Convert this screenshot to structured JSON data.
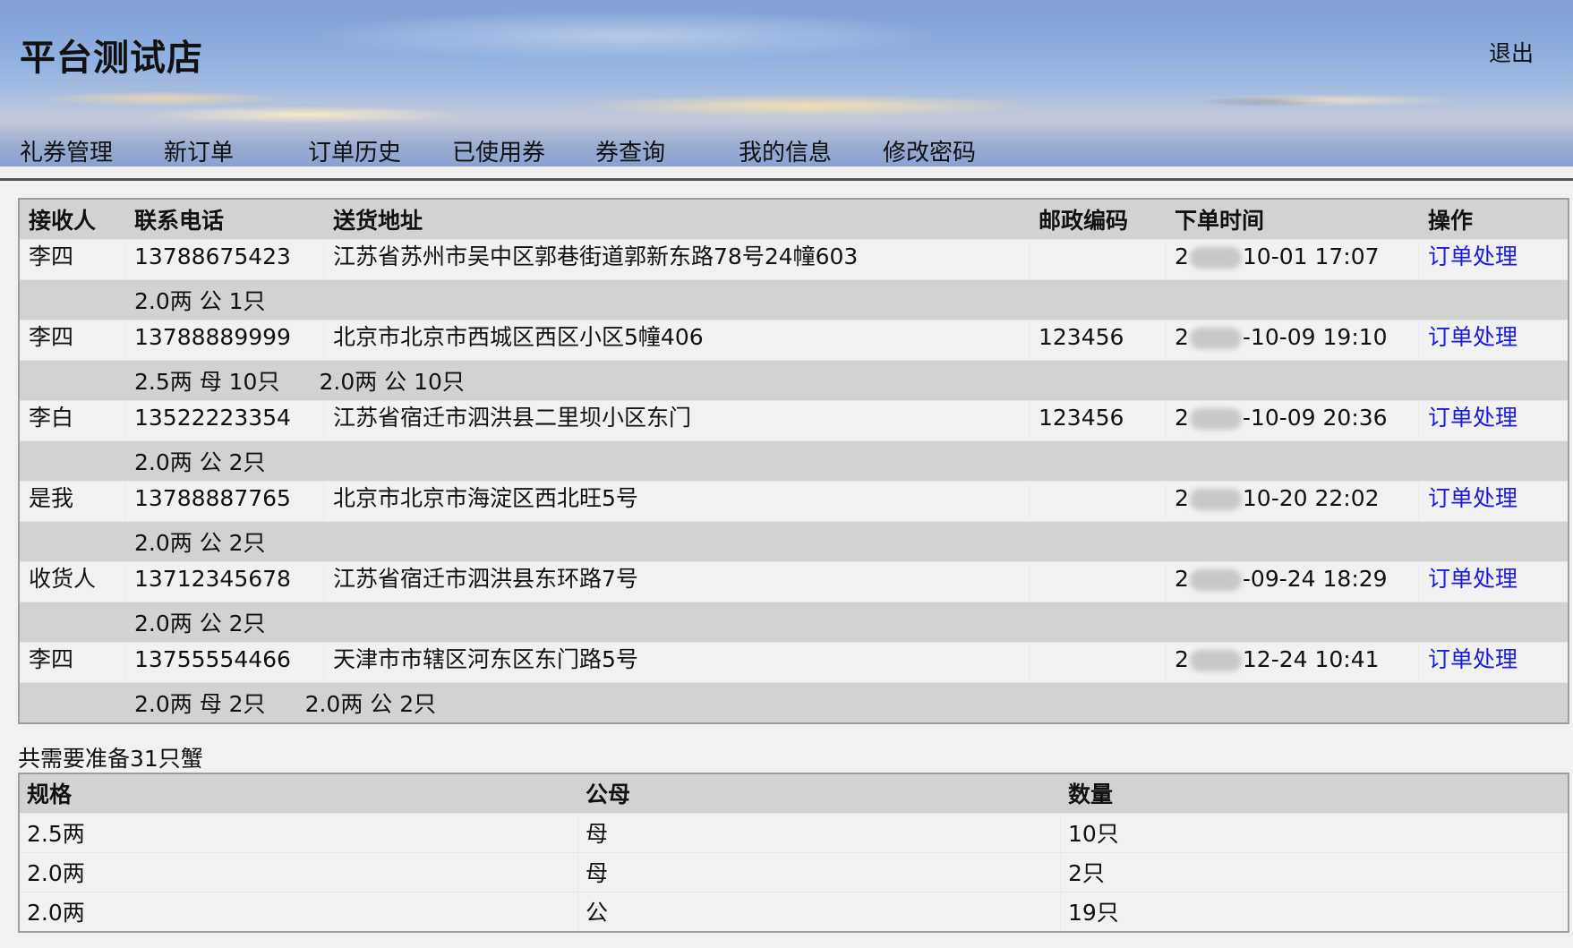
{
  "header": {
    "title": "平台测试店",
    "logout": "退出"
  },
  "nav": [
    "礼券管理",
    "新订单",
    "订单历史",
    "已使用券",
    "券查询",
    "我的信息",
    "修改密码"
  ],
  "orders": {
    "columns": [
      "接收人",
      "联系电话",
      "送货地址",
      "邮政编码",
      "下单时间",
      "操作"
    ],
    "rows": [
      {
        "receiver": "李四",
        "phone": "13788675423",
        "address": "江苏省苏州市吴中区郭巷街道郭新东路78号24幢603",
        "postcode": "",
        "time_prefix": "2",
        "time_suffix": "10-01 17:07",
        "action": "订单处理",
        "items": [
          "2.0两 公 1只"
        ]
      },
      {
        "receiver": "李四",
        "phone": "13788889999",
        "address": "北京市北京市西城区西区小区5幢406",
        "postcode": "123456",
        "time_prefix": "2",
        "time_suffix": "-10-09 19:10",
        "action": "订单处理",
        "items": [
          "2.5两 母 10只",
          "2.0两 公 10只"
        ]
      },
      {
        "receiver": "李白",
        "phone": "13522223354",
        "address": "江苏省宿迁市泗洪县二里坝小区东门",
        "postcode": "123456",
        "time_prefix": "2",
        "time_suffix": "-10-09 20:36",
        "action": "订单处理",
        "items": [
          "2.0两 公 2只"
        ]
      },
      {
        "receiver": "是我",
        "phone": "13788887765",
        "address": "北京市北京市海淀区西北旺5号",
        "postcode": "",
        "time_prefix": "2",
        "time_suffix": "10-20 22:02",
        "action": "订单处理",
        "items": [
          "2.0两 公 2只"
        ]
      },
      {
        "receiver": "收货人",
        "phone": "13712345678",
        "address": "江苏省宿迁市泗洪县东环路7号",
        "postcode": "",
        "time_prefix": "2",
        "time_suffix": "-09-24 18:29",
        "action": "订单处理",
        "items": [
          "2.0两 公 2只"
        ]
      },
      {
        "receiver": "李四",
        "phone": "13755554466",
        "address": "天津市市辖区河东区东门路5号",
        "postcode": "",
        "time_prefix": "2",
        "time_suffix": "12-24 10:41",
        "action": "订单处理",
        "items": [
          "2.0两 母 2只",
          "2.0两 公 2只"
        ]
      }
    ]
  },
  "summary": "共需要准备31只蟹",
  "totals": {
    "columns": [
      "规格",
      "公母",
      "数量"
    ],
    "rows": [
      [
        "2.5两",
        "母",
        "10只"
      ],
      [
        "2.0两",
        "母",
        "2只"
      ],
      [
        "2.0两",
        "公",
        "19只"
      ]
    ]
  }
}
